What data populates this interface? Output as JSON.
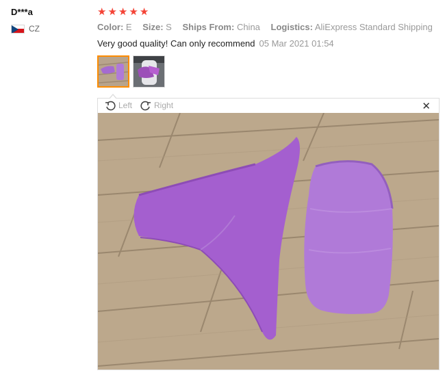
{
  "user": {
    "name": "D***a",
    "country": "CZ",
    "flag_icon": "czech-flag-icon"
  },
  "rating": {
    "stars": 5,
    "max": 5,
    "star_color": "#f44336"
  },
  "meta": {
    "color_label": "Color:",
    "color_value": "E",
    "size_label": "Size:",
    "size_value": "S",
    "ships_label": "Ships From:",
    "ships_value": "China",
    "logistics_label": "Logistics:",
    "logistics_value": "AliExpress Standard Shipping"
  },
  "review": {
    "text": "Very good quality! Can only recommend",
    "date": "05 Mar 2021 01:54"
  },
  "thumbnails": {
    "count": 2,
    "active_index": 0,
    "active_color": "#ff8c00"
  },
  "viewer": {
    "rotate_left_label": "Left",
    "rotate_right_label": "Right",
    "close_icon": "close-icon"
  }
}
